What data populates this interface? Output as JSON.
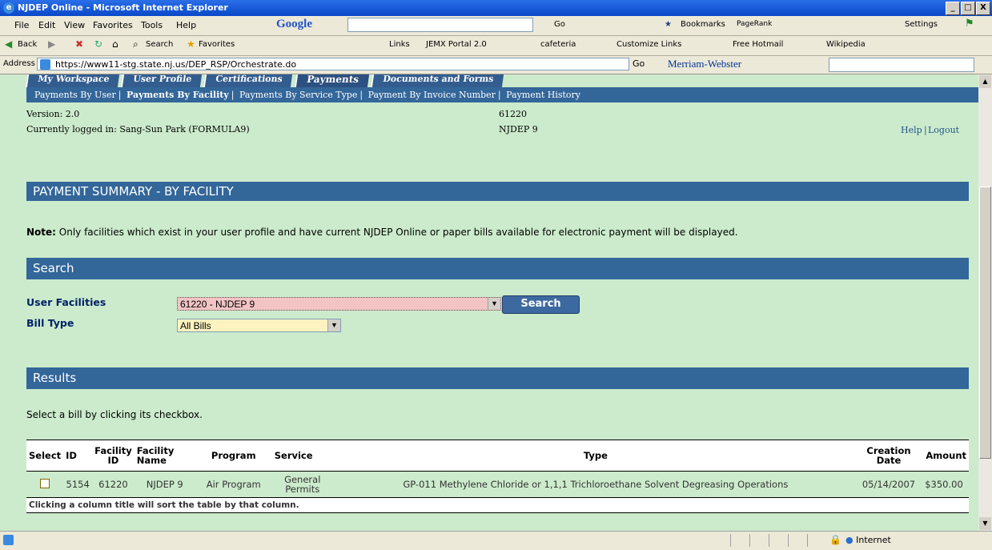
{
  "window": {
    "title": "NJDEP Online - Microsoft Internet Explorer",
    "controls": [
      "_",
      "□",
      "X"
    ]
  },
  "menubar": {
    "items": [
      "File",
      "Edit",
      "View",
      "Favorites",
      "Tools",
      "Help"
    ],
    "google_label": "Google",
    "go_label": "Go",
    "bookmarks_label": "Bookmarks",
    "pagerank_label": "PageRank",
    "settings_label": "Settings"
  },
  "toolbar": {
    "back_label": "Back",
    "search_label": "Search",
    "favorites_label": "Favorites",
    "links_label": "Links",
    "links": [
      "JEMX Portal 2.0",
      "cafeteria",
      "Customize Links",
      "Free Hotmail",
      "Wikipedia"
    ]
  },
  "address": {
    "label": "Address",
    "url": "https://www11-stg.state.nj.us/DEP_RSP/Orchestrate.do",
    "go_label": "Go",
    "dictionary_label": "Merriam-Webster"
  },
  "tabs": [
    "My Workspace",
    "User Profile",
    "Certifications",
    "Payments",
    "Documents and Forms"
  ],
  "active_tab": "Payments",
  "subnav": {
    "items": [
      "Payments By User",
      "Payments By Facility",
      "Payments By Service Type",
      "Payment By Invoice Number",
      "Payment History"
    ],
    "active": "Payments By Facility"
  },
  "info": {
    "version": "Version: 2.0",
    "logged_in": "Currently logged in: Sang-Sun Park (FORMULA9)",
    "facility_id": "61220",
    "facility_name": "NJDEP 9",
    "help_label": "Help",
    "logout_label": "Logout"
  },
  "page_title": "PAYMENT SUMMARY - BY FACILITY",
  "note": {
    "label": "Note:",
    "text": " Only facilities which exist in your user profile and have current NJDEP Online or paper bills available for electronic payment will be displayed."
  },
  "search": {
    "header": "Search",
    "facilities_label": "User Facilities",
    "facilities_value": "61220 - NJDEP 9",
    "bill_type_label": "Bill Type",
    "bill_type_value": "All Bills",
    "button_label": "Search"
  },
  "results": {
    "header": "Results",
    "instruction": "Select a bill by clicking its checkbox.",
    "columns": [
      "Select",
      "ID",
      "Facility ID",
      "Facility Name",
      "Program",
      "Service",
      "Type",
      "Creation Date",
      "Amount"
    ],
    "rows": [
      {
        "id": "5154",
        "facility_id": "61220",
        "facility_name": "NJDEP 9",
        "program": "Air Program",
        "service": "General Permits",
        "type": "GP-011 Methylene Chloride or 1,1,1 Trichloroethane Solvent Degreasing Operations",
        "creation_date": "05/14/2007",
        "amount": "$350.00"
      }
    ],
    "footer": "Clicking a column title will sort the table by that column."
  },
  "status": {
    "zone": "Internet"
  },
  "colors": {
    "page_bg": "#ccebcc",
    "header_blue": "#336699",
    "select_highlight": "#f2c4c4",
    "select_bg": "#fdf3c0"
  }
}
